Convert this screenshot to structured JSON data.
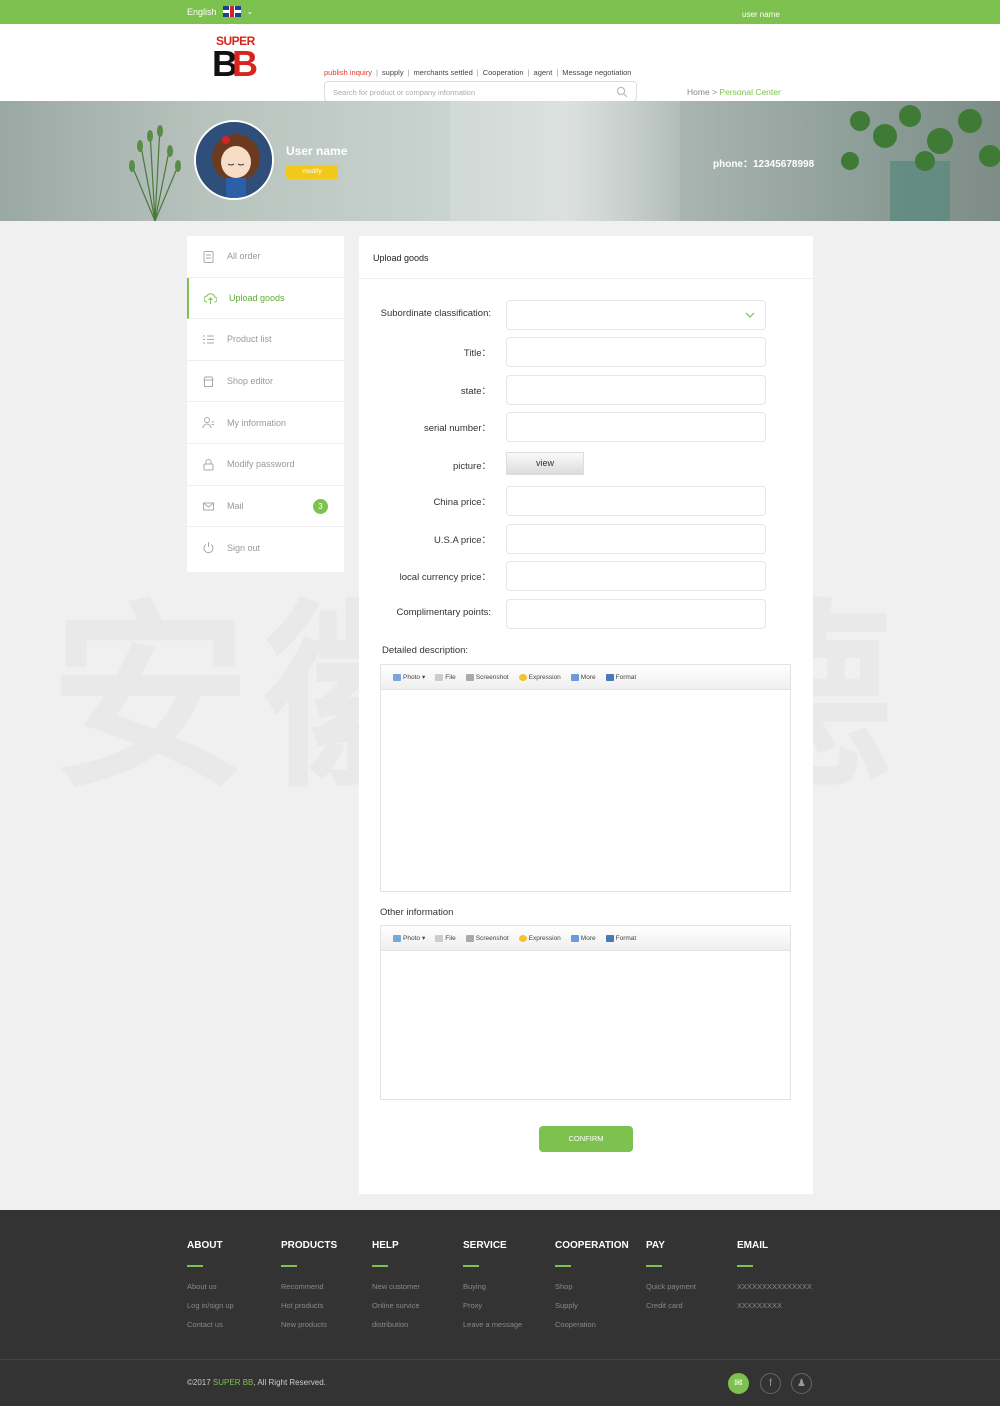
{
  "topbar": {
    "language": "English",
    "user_name": "user name"
  },
  "header": {
    "logo_top": "SUPER",
    "logo_main_black": "B",
    "logo_main_red": "B",
    "nav": [
      "publish inquiry",
      "supply",
      "merchants settled",
      "Cooperation",
      "agent",
      "Message negotiation"
    ],
    "search_placeholder": "Search for product or company information",
    "breadcrumb_home": "Home",
    "breadcrumb_sep": ">",
    "breadcrumb_current": "Personal Center"
  },
  "profile": {
    "name": "User name",
    "modify": "modify",
    "phone": "phone：12345678998"
  },
  "sidebar": {
    "items": [
      {
        "label": "All order",
        "icon": "clipboard-icon"
      },
      {
        "label": "Upload goods",
        "icon": "cloud-upload-icon",
        "active": true
      },
      {
        "label": "Product list",
        "icon": "list-icon"
      },
      {
        "label": "Shop editor",
        "icon": "shop-icon"
      },
      {
        "label": "My information",
        "icon": "user-icon"
      },
      {
        "label": "Modify password",
        "icon": "lock-icon"
      },
      {
        "label": "Mail",
        "icon": "mail-icon",
        "badge": "3"
      },
      {
        "label": "Sign out",
        "icon": "power-icon"
      }
    ]
  },
  "form": {
    "title": "Upload goods",
    "fields": [
      {
        "label": "Subordinate classification:"
      },
      {
        "label": "Title："
      },
      {
        "label": "state："
      },
      {
        "label": "serial number："
      },
      {
        "label": "picture："
      },
      {
        "label": "China price："
      },
      {
        "label": "U.S.A price："
      },
      {
        "label": "local currency price："
      },
      {
        "label": "Complimentary points:"
      }
    ],
    "view_button": "view",
    "detailed_label": "Detailed description:",
    "other_label": "Other information",
    "toolbar": [
      "Photo",
      "File",
      "Screenshot",
      "Expression",
      "More",
      "Format"
    ],
    "confirm": "CONFIRM"
  },
  "watermark": "安徽邦德",
  "footer": {
    "columns": [
      {
        "title": "ABOUT",
        "links": [
          "About us",
          "Log in/sign up",
          "Contact us"
        ]
      },
      {
        "title": "PRODUCTS",
        "links": [
          "Recommend",
          "Hot products",
          "New products"
        ]
      },
      {
        "title": "HELP",
        "links": [
          "New customer",
          "Online survice",
          "distribution"
        ]
      },
      {
        "title": "SERVICE",
        "links": [
          "Buying",
          "Proxy",
          "Leave a message"
        ]
      },
      {
        "title": "COOPERATION",
        "links": [
          "Shop",
          "Supply",
          "Cooperation"
        ]
      },
      {
        "title": "PAY",
        "links": [
          "Quick payment",
          "Credit card"
        ]
      },
      {
        "title": "EMAIL",
        "links": [
          "XXXXXXXXXXXXXXX",
          "XXXXXXXXX"
        ]
      }
    ],
    "copyright_prefix": "©2017 ",
    "copyright_brand": "SUPER BB",
    ",copyright_suffix": "",
    "copyright_rest": ", All Right Reserved.",
    "social": [
      "wechat-icon",
      "facebook-icon",
      "qq-icon"
    ]
  },
  "colors": {
    "accent": "#7dc14f",
    "footer_bg": "#333333",
    "badge_yellow": "#f0c91a",
    "nav_active": "#e33a2a"
  }
}
